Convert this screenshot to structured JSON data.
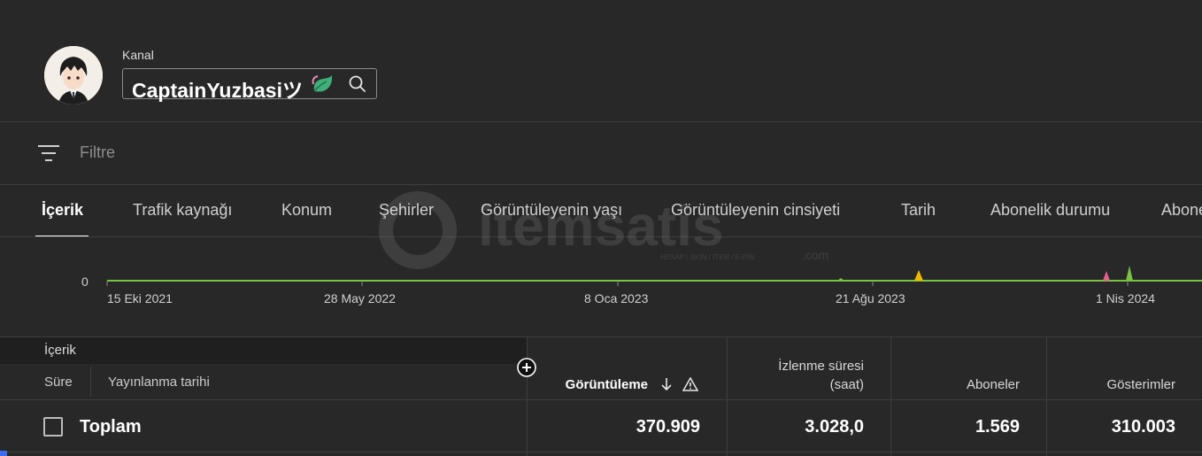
{
  "header": {
    "label": "Kanal",
    "channel_name": "CaptainYuzbasiツ",
    "icons": [
      "leaf-icon",
      "search-icon"
    ]
  },
  "filter": {
    "placeholder": "Filtre",
    "icon": "filter-icon"
  },
  "tabs": [
    {
      "label": "İçerik",
      "active": true
    },
    {
      "label": "Trafik kaynağı"
    },
    {
      "label": "Konum"
    },
    {
      "label": "Şehirler"
    },
    {
      "label": "Görüntüleyenin yaşı"
    },
    {
      "label": "Görüntüleyenin cinsiyeti"
    },
    {
      "label": "Tarih"
    },
    {
      "label": "Abonelik durumu"
    },
    {
      "label": "Abone"
    }
  ],
  "watermark": {
    "brand": "itemsatis",
    "tagline": "HESAP / SKIN / ITEM / E-PIN",
    "suffix": ".com"
  },
  "chart_data": {
    "type": "line",
    "x_ticks": [
      "15 Eki 2021",
      "28 May 2022",
      "8 Oca 2023",
      "21 Ağu 2023",
      "1 Nis 2024"
    ],
    "y_ticks": [
      "0"
    ],
    "grid": false,
    "colors": {
      "baseline": "#7cc242",
      "spike_yellow": "#f2b705",
      "spike_pink": "#e0628a",
      "spike_green": "#7cc242"
    }
  },
  "table": {
    "group_label": "İçerik",
    "columns": {
      "duration": "Süre",
      "publish_date": "Yayınlanma tarihi",
      "views": "Görüntüleme",
      "watch_time_line1": "İzlenme süresi",
      "watch_time_line2": "(saat)",
      "subscribers": "Aboneler",
      "impressions": "Gösterimler"
    },
    "total": {
      "label": "Toplam",
      "views": "370.909",
      "watch_time": "3.028,0",
      "subscribers": "1.569",
      "impressions": "310.003"
    }
  },
  "colors": {
    "background": "#282828",
    "accent": "#3d6df2"
  }
}
